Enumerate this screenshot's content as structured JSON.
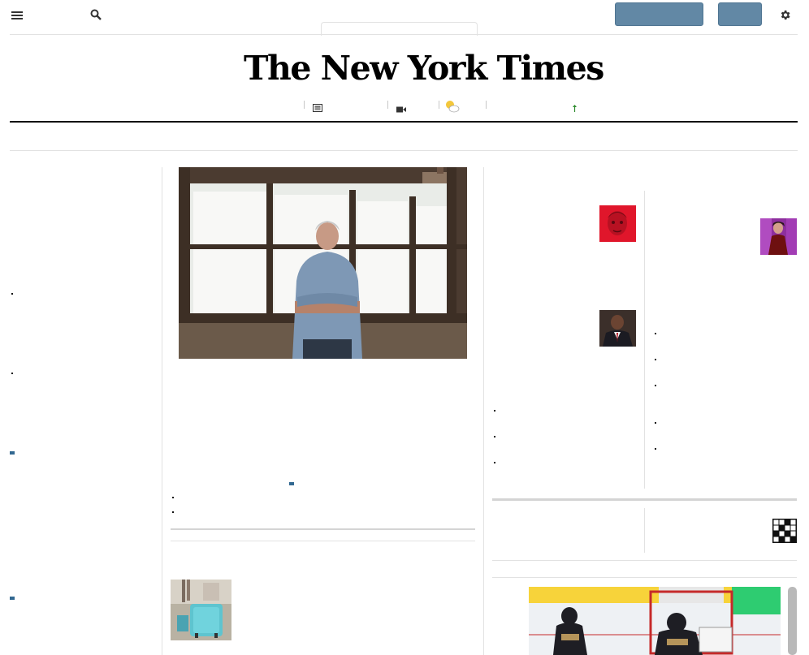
{
  "header": {
    "menu_icon": "hamburger-menu-icon",
    "search_icon": "search-icon",
    "settings_icon": "gear-icon",
    "subscribe_label": "",
    "login_label": "",
    "edition_tab_label": ""
  },
  "masthead": {
    "title": "The New York Times"
  },
  "nav": {
    "todays_paper_icon": "newspaper-icon",
    "video_icon": "video-camera-icon",
    "weather_icon": "partly-cloudy-icon",
    "markets_icon": "arrow-up-icon",
    "items": [
      "",
      "",
      "",
      ""
    ]
  },
  "colors": {
    "accent": "#326891",
    "button": "#6288a5",
    "rule": "#e2e2e2",
    "market_up": "#2f8c2f"
  },
  "content": {
    "lead_photo_alt": "",
    "thumb_photo_alt": "",
    "hockey_photo_alt": ""
  }
}
